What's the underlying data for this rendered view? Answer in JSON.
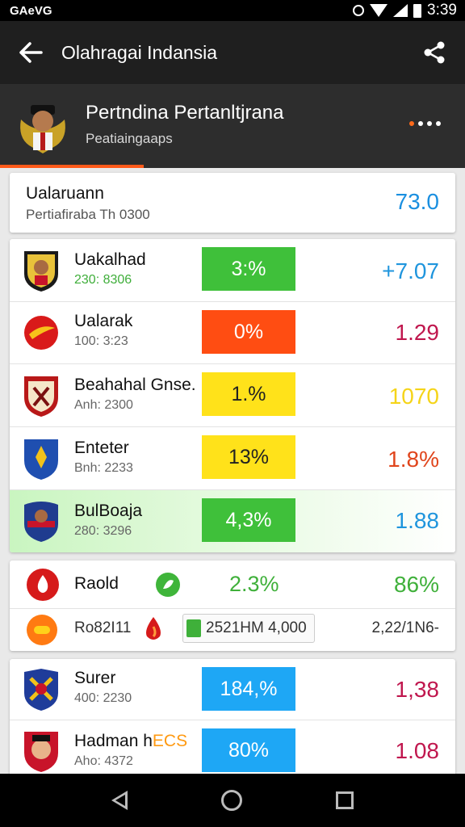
{
  "status_bar": {
    "left_text": "GAeVG",
    "time": "3:39"
  },
  "app_bar": {
    "title": "Olahragai Indansia"
  },
  "header": {
    "title": "Pertndina Pertanltjrana",
    "subtitle": "Peatiaingaaps"
  },
  "summary": {
    "title": "Ualaruann",
    "subtitle": "Pertiafiraba Th 0300",
    "value": "73.0"
  },
  "rows": [
    {
      "name": "Uakalhad",
      "meta": "230: 8306",
      "pill": "3:%",
      "pill_color": "#3fc03a",
      "value": "+7.07",
      "value_color": "#1f95dd",
      "meta_color": "#3fae3a"
    },
    {
      "name": "Ualarak",
      "meta": "100: 3:23",
      "pill": "0%",
      "pill_color": "#ff4d12",
      "value": "1.29",
      "value_color": "#c0174e",
      "meta_color": "#666666"
    },
    {
      "name": "Beahahal Gnse.",
      "meta": "Anh: 2300",
      "pill": "1.%",
      "pill_color": "#ffe21a",
      "value": "1070",
      "value_color": "#f5d419",
      "meta_color": "#666666"
    },
    {
      "name": "Enteter",
      "meta": "Bnh: 2233",
      "pill": "13%",
      "pill_color": "#ffe21a",
      "value": "1.8%",
      "value_color": "#e0451c",
      "meta_color": "#666666"
    },
    {
      "name": "BulBoaja",
      "meta": "280: 3296",
      "pill": "4,3%",
      "pill_color": "#3fc03a",
      "value": "1.88",
      "value_color": "#1f95dd",
      "meta_color": "#666666"
    }
  ],
  "mid_group": {
    "line1": {
      "name": "Raold",
      "pct": "2.3%",
      "value": "86%"
    },
    "line2": {
      "label": "Ro82I11",
      "field": "2521HM 4,000",
      "value": "2,22/1N6-"
    }
  },
  "bottom_rows": [
    {
      "name": "Surer",
      "meta": "400: 2230",
      "pill": "184,%",
      "pill_color": "#1ea7f5",
      "value": "1,38",
      "value_color": "#c0174e"
    },
    {
      "name": "Hadman h",
      "badge": "ECS",
      "meta": "Aho: 4372",
      "pill": "80%",
      "pill_color": "#1ea7f5",
      "value": "1.08",
      "value_color": "#c0174e"
    }
  ],
  "colors": {
    "accent": "#ff5a1a",
    "appbar": "#1f1f1f",
    "header": "#2d2d2d",
    "positive": "#3fb03a",
    "blue": "#1f95dd"
  },
  "icons": [
    "back-arrow-icon",
    "share-icon",
    "more-dots-icon",
    "team-crest-icon",
    "nav-back-icon",
    "nav-home-icon",
    "nav-recents-icon"
  ]
}
